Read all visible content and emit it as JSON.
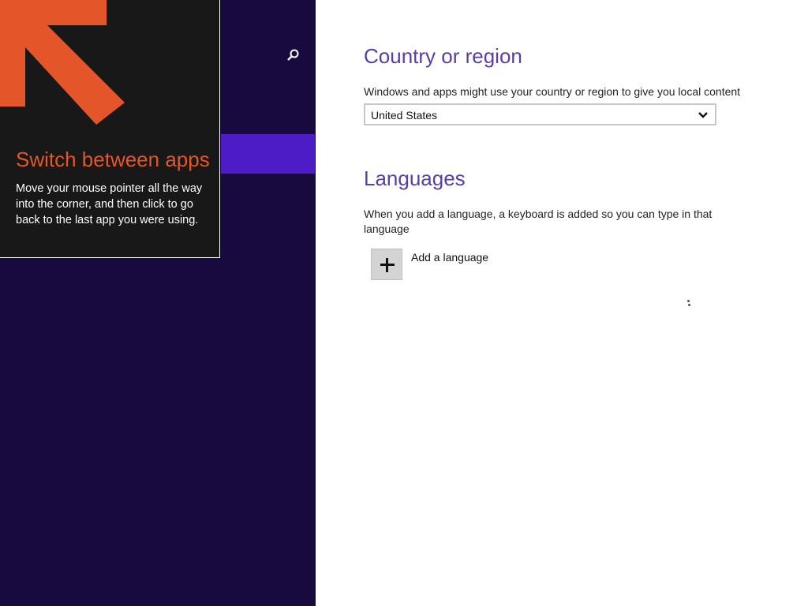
{
  "tip": {
    "title": "Switch between apps",
    "body": "Move your mouse pointer all the way into the corner, and then click to go back to the last app you were using."
  },
  "region": {
    "title": "Country or region",
    "description": "Windows and apps might use your country or region to give you local content",
    "selected": "United States"
  },
  "languages": {
    "title": "Languages",
    "description": "When you add a language, a keyboard is added so you can type in that language",
    "add_label": "Add a language"
  },
  "colors": {
    "left_pane": "#180a3f",
    "selected_band": "#4d1cc7",
    "tip_accent": "#e4552a",
    "heading": "#5a3ea6"
  },
  "icons": {
    "search": "search-icon",
    "tip_arrow": "corner-arrow-icon",
    "dropdown": "chevron-down-icon",
    "add": "plus-icon"
  }
}
